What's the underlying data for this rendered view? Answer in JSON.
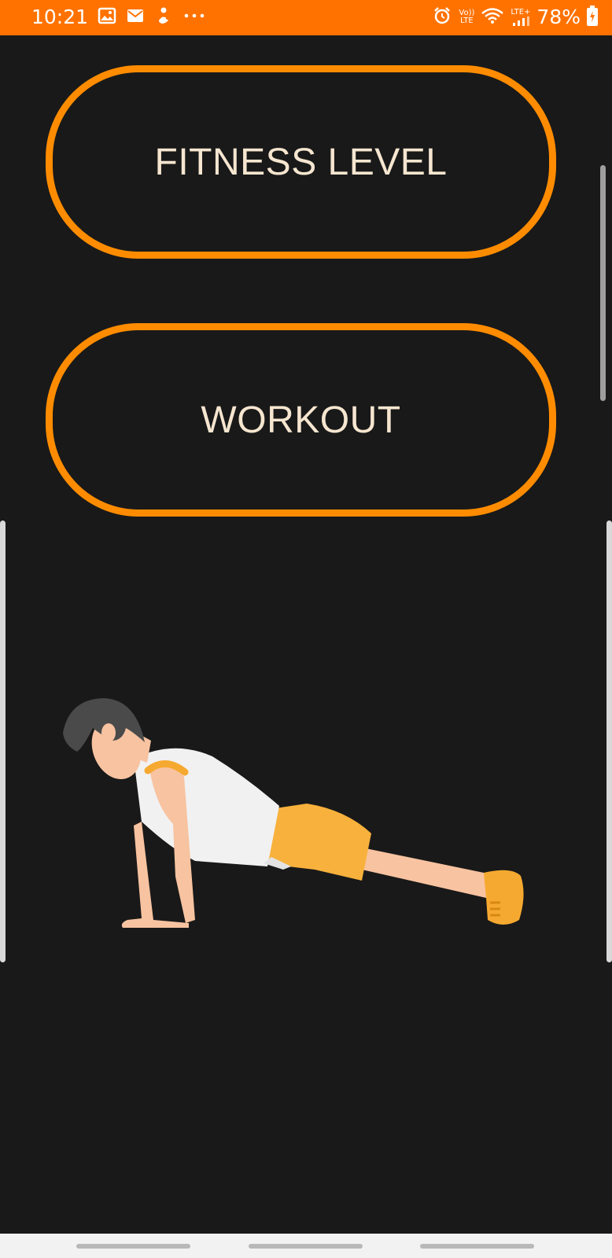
{
  "status_bar": {
    "time": "10:21",
    "battery_percent": "78%",
    "network_label_top": "Vo))",
    "network_label_bottom": "LTE",
    "lte_label": "LTE+",
    "notification_icons": [
      "image-icon",
      "mail-icon",
      "person-icon",
      "more-dots-icon"
    ],
    "system_icons": [
      "alarm-icon",
      "volte-icon",
      "wifi-icon",
      "lte-signal-icon",
      "battery-icon"
    ],
    "color": "#ff7200"
  },
  "buttons": {
    "fitness_level_label": "FITNESS LEVEL",
    "workout_label": "WORKOUT",
    "border_color": "#ff8c00",
    "text_color": "#f6e6d0"
  },
  "illustration": {
    "name": "pushup-person-illustration"
  },
  "theme": {
    "background": "#191919"
  }
}
